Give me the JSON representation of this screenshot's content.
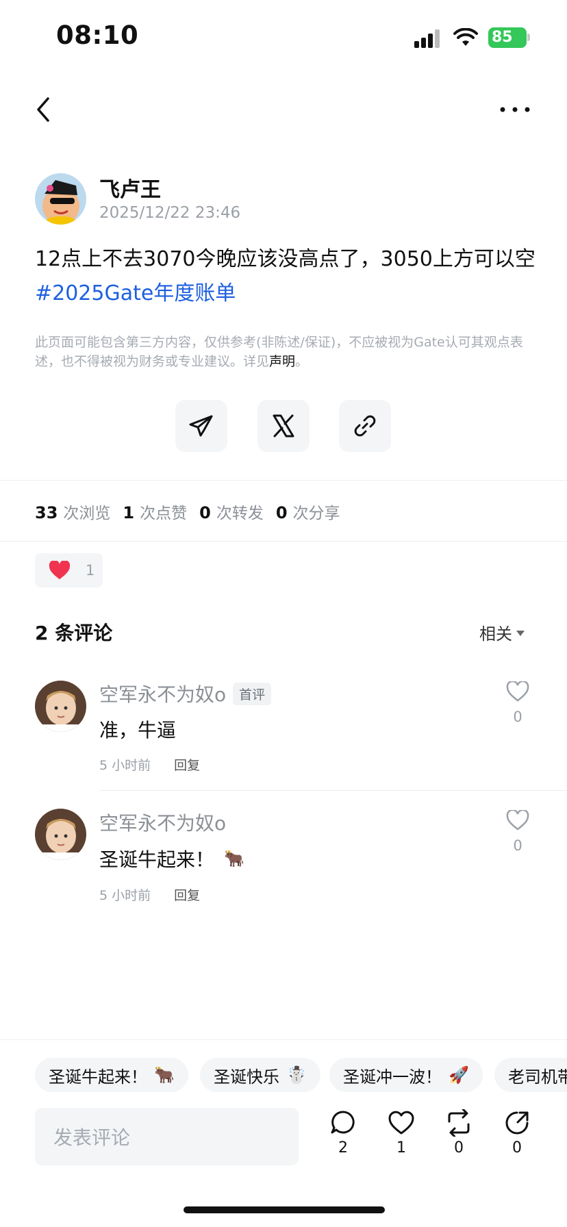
{
  "status_bar": {
    "time": "08:10",
    "battery": "85"
  },
  "post": {
    "author": "飞卢王",
    "timestamp": "2025/12/22 23:46",
    "text": "12点上不去3070今晚应该没高点了，3050上方可以空",
    "hashtag": "#2025Gate年度账单",
    "disclaimer": "此页面可能包含第三方内容，仅供参考(非陈述/保证)，不应被视为Gate认可其观点表述，也不得被视为财务或专业建议。详见",
    "disclaimer_link": "声明",
    "disclaimer_end": "。"
  },
  "share": {
    "telegram": "telegram-icon",
    "x": "x-icon",
    "link": "link-icon"
  },
  "stats": {
    "views_count": "33",
    "views_label": "次浏览",
    "likes_count": "1",
    "likes_label": "次点赞",
    "reposts_count": "0",
    "reposts_label": "次转发",
    "shares_count": "0",
    "shares_label": "次分享"
  },
  "reaction": {
    "emoji": "❤️",
    "count": "1"
  },
  "comments": {
    "title": "2 条评论",
    "sort_label": "相关",
    "items": [
      {
        "name": "空军永不为奴o",
        "badge": "首评",
        "text": "准，牛逼",
        "time": "5 小时前",
        "reply": "回复",
        "likes": "0"
      },
      {
        "name": "空军永不为奴o",
        "badge": "",
        "text": "圣诞牛起来！",
        "emoji": "🐂",
        "time": "5 小时前",
        "reply": "回复",
        "likes": "0"
      }
    ]
  },
  "quick_replies": [
    {
      "text": "圣诞牛起来！",
      "emoji": "🐂"
    },
    {
      "text": "圣诞快乐",
      "emoji": "☃️"
    },
    {
      "text": "圣诞冲一波！",
      "emoji": "🚀"
    },
    {
      "text": "老司机带",
      "emoji": ""
    }
  ],
  "bottom_bar": {
    "input_placeholder": "发表评论",
    "comments": "2",
    "likes": "1",
    "reposts": "0",
    "shares": "0"
  },
  "colors": {
    "accent_link": "#1d5fe0",
    "battery_green": "#34c759",
    "heart_red": "#f0344f"
  }
}
